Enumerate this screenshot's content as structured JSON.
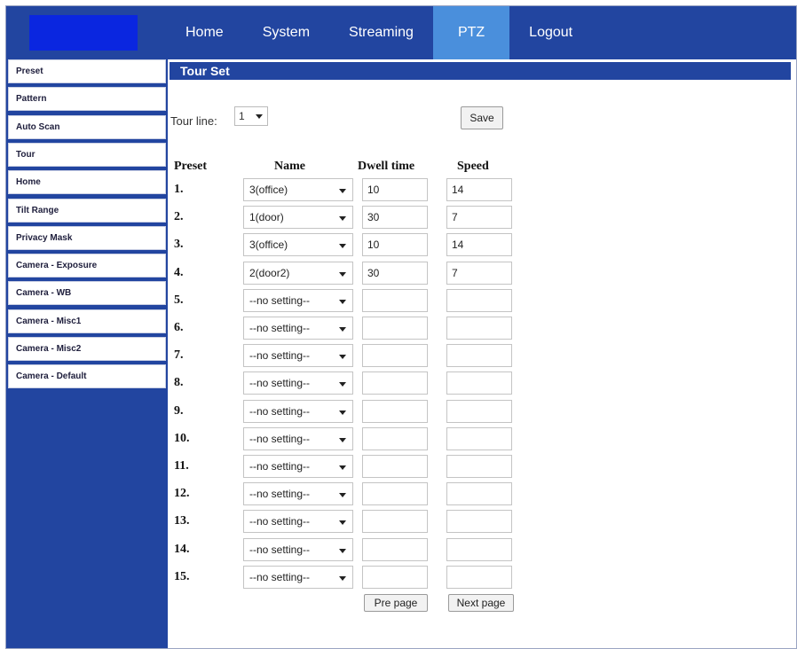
{
  "nav": {
    "items": [
      {
        "label": "Home",
        "active": false
      },
      {
        "label": "System",
        "active": false
      },
      {
        "label": "Streaming",
        "active": false
      },
      {
        "label": "PTZ",
        "active": true
      },
      {
        "label": "Logout",
        "active": false
      }
    ]
  },
  "sidebar": {
    "items": [
      "Preset",
      "Pattern",
      "Auto Scan",
      "Tour",
      "Home",
      "Tilt Range",
      "Privacy Mask",
      "Camera - Exposure",
      "Camera - WB",
      "Camera - Misc1",
      "Camera - Misc2",
      "Camera - Default"
    ]
  },
  "section": {
    "title": "Tour Set"
  },
  "tour_line": {
    "label": "Tour line:",
    "value": "1"
  },
  "buttons": {
    "save": "Save",
    "pre_page": "Pre page",
    "next_page": "Next page"
  },
  "columns": {
    "preset": "Preset",
    "name": "Name",
    "dwell": "Dwell time",
    "speed": "Speed"
  },
  "rows": [
    {
      "num": "1.",
      "name": "3(office)",
      "dwell": "10",
      "speed": "14"
    },
    {
      "num": "2.",
      "name": "1(door)",
      "dwell": "30",
      "speed": "7"
    },
    {
      "num": "3.",
      "name": "3(office)",
      "dwell": "10",
      "speed": "14"
    },
    {
      "num": "4.",
      "name": "2(door2)",
      "dwell": "30",
      "speed": "7"
    },
    {
      "num": "5.",
      "name": "--no setting--",
      "dwell": "",
      "speed": ""
    },
    {
      "num": "6.",
      "name": "--no setting--",
      "dwell": "",
      "speed": ""
    },
    {
      "num": "7.",
      "name": "--no setting--",
      "dwell": "",
      "speed": ""
    },
    {
      "num": "8.",
      "name": "--no setting--",
      "dwell": "",
      "speed": ""
    },
    {
      "num": "9.",
      "name": "--no setting--",
      "dwell": "",
      "speed": ""
    },
    {
      "num": "10.",
      "name": "--no setting--",
      "dwell": "",
      "speed": ""
    },
    {
      "num": "11.",
      "name": "--no setting--",
      "dwell": "",
      "speed": ""
    },
    {
      "num": "12.",
      "name": "--no setting--",
      "dwell": "",
      "speed": ""
    },
    {
      "num": "13.",
      "name": "--no setting--",
      "dwell": "",
      "speed": ""
    },
    {
      "num": "14.",
      "name": "--no setting--",
      "dwell": "",
      "speed": ""
    },
    {
      "num": "15.",
      "name": "--no setting--",
      "dwell": "",
      "speed": ""
    }
  ],
  "colors": {
    "brand": "#2245a0",
    "nav_active": "#4a8fdc",
    "logo": "#0a26e0"
  }
}
